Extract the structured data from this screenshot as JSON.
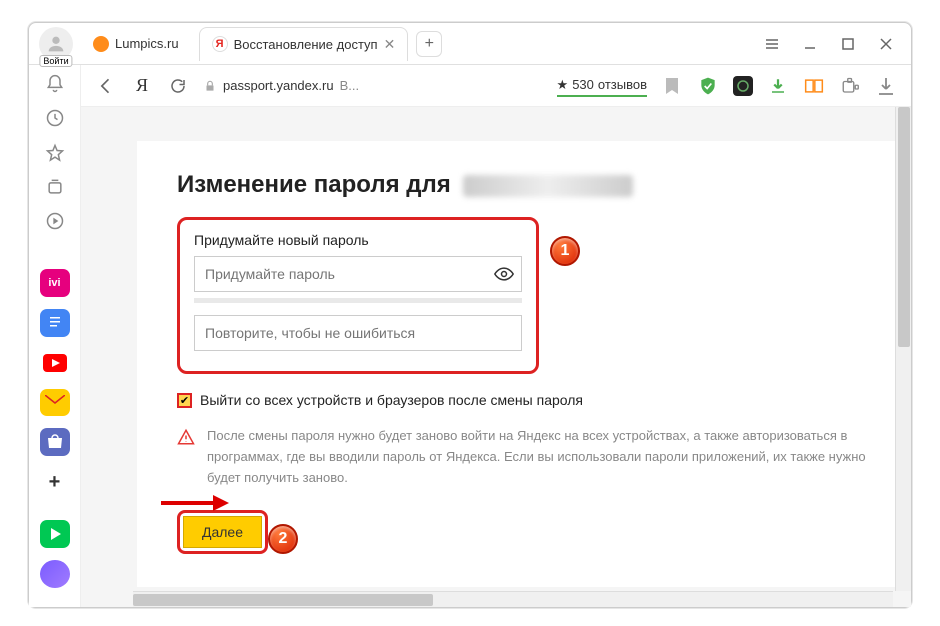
{
  "login_badge": "Войти",
  "tabs": [
    {
      "label": "Lumpics.ru"
    },
    {
      "label": "Восстановление доступ"
    }
  ],
  "url": {
    "host": "passport.yandex.ru",
    "suffix": "В..."
  },
  "reviews": {
    "count": "530",
    "word": "отзывов"
  },
  "page": {
    "title": "Изменение пароля для",
    "field_label": "Придумайте новый пароль",
    "placeholder1": "Придумайте пароль",
    "placeholder2": "Повторите, чтобы не ошибиться",
    "checkbox_label": "Выйти со всех устройств и браузеров после смены пароля",
    "warning": "После смены пароля нужно будет заново войти на Яндекс на всех устройствах, а также авторизоваться в программах, где вы вводили пароль от Яндекса. Если вы использовали пароли приложений, их также нужно будет получить заново.",
    "next_label": "Далее"
  },
  "annotations": {
    "b1": "1",
    "b2": "2"
  }
}
